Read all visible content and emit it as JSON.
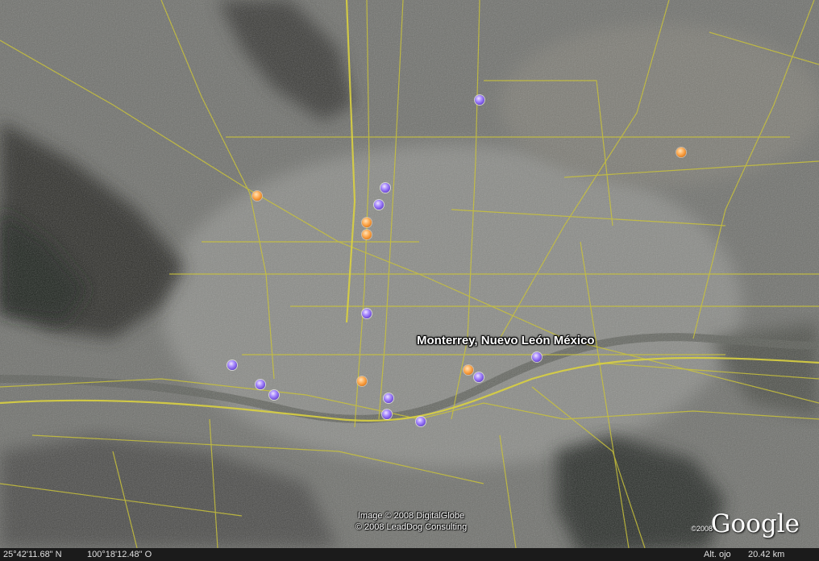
{
  "map": {
    "place_label": "Monterrey, Nuevo León México",
    "credits": [
      "Image © 2008 DigitalGlobe",
      "© 2008 LeadDog Consulting"
    ],
    "logo_text": "Google",
    "logo_year": "©2008",
    "marker_colors": {
      "purple": "#8a6cf0",
      "orange": "#f59a3a"
    },
    "road_color": "#c9c23a"
  },
  "status": {
    "latitude": "25°42'11.68\" N",
    "longitude": "100°18'12.48\" O",
    "altitude_label": "Alt. ojo",
    "altitude_value": "20.42 km"
  }
}
